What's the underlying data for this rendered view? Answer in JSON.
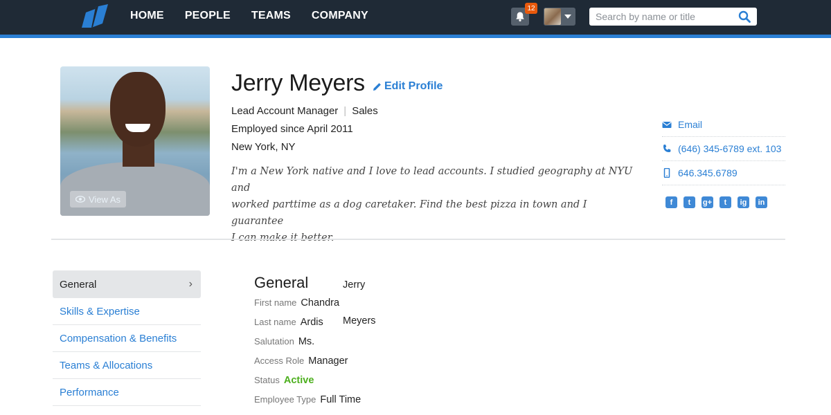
{
  "nav": {
    "items": [
      "HOME",
      "PEOPLE",
      "TEAMS",
      "COMPANY"
    ],
    "notifications_count": "12",
    "search_placeholder": "Search by name or title"
  },
  "profile": {
    "name": "Jerry Meyers",
    "edit_label": "Edit Profile",
    "title": "Lead Account Manager",
    "department": "Sales",
    "employed": "Employed since April 2011",
    "location": "New York, NY",
    "bio_lines": [
      "I'm a New York native and I love to lead accounts. I studied geography at NYU and",
      "worked parttime as a dog caretaker. Find the best pizza in town and I guarantee",
      "I can make it better."
    ],
    "view_as_label": "View As"
  },
  "contact": {
    "email": "Email",
    "phone": "(646) 345-6789 ext. 103",
    "mobile": "646.345.6789",
    "social": [
      "f",
      "t",
      "g+",
      "t",
      "ig",
      "in"
    ]
  },
  "sidebar": {
    "items": [
      {
        "label": "General",
        "active": true
      },
      {
        "label": "Skills & Expertise"
      },
      {
        "label": "Compensation & Benefits"
      },
      {
        "label": "Teams & Allocations"
      },
      {
        "label": "Performance"
      }
    ]
  },
  "general": {
    "title": "General",
    "overlay_first": "Jerry",
    "overlay_last": "Meyers",
    "fields": [
      {
        "label": "First name",
        "value": "Chandra"
      },
      {
        "label": "Last name",
        "value": "Ardis"
      },
      {
        "label": "Salutation",
        "value": "Ms."
      },
      {
        "label": "Access Role",
        "value": "Manager"
      },
      {
        "label": "Status",
        "value": "Active"
      },
      {
        "label": "Employee Type",
        "value": "Full Time"
      }
    ]
  },
  "colors": {
    "accent": "#2a7fd4",
    "topbar": "#1f2a36",
    "status_active": "#4caf1d",
    "badge": "#e8590c"
  }
}
